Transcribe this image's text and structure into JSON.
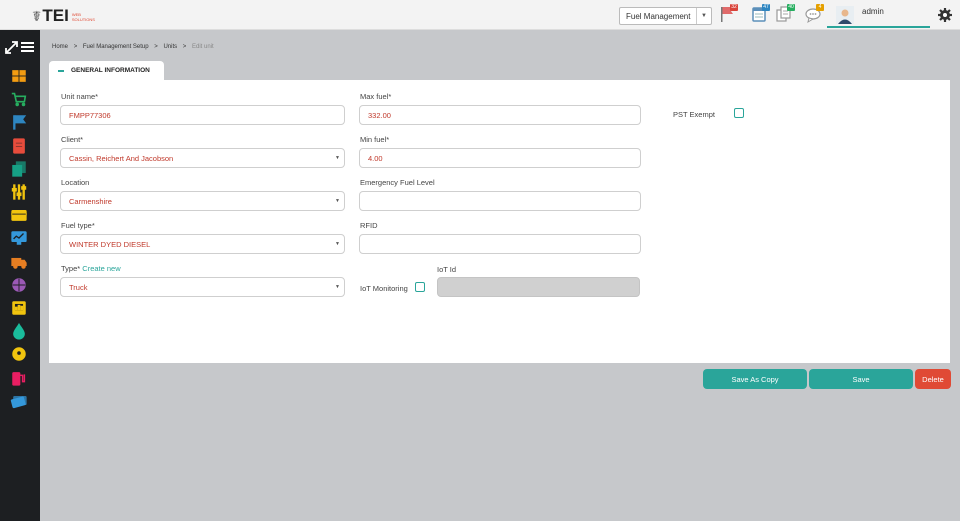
{
  "header": {
    "logo": {
      "brand": "TEI",
      "sub_line1": "WEB",
      "sub_line2": "SOLUTIONS"
    },
    "module_select": {
      "value": "Fuel Management"
    },
    "notifications": [
      {
        "icon": "flag-icon",
        "count": "32",
        "color": "#d9433a"
      },
      {
        "icon": "calendar-icon",
        "count": "47",
        "color": "#2e86c1"
      },
      {
        "icon": "document-icon",
        "count": "40",
        "color": "#27ae60"
      },
      {
        "icon": "chat-icon",
        "count": "4",
        "color": "#e5a000"
      }
    ],
    "user": {
      "name": "admin"
    }
  },
  "sidebar": {
    "items": [
      {
        "icon": "dashboard-icon",
        "color": "#f39c12"
      },
      {
        "icon": "cart-icon",
        "color": "#27ae60"
      },
      {
        "icon": "flag-icon",
        "color": "#2e86c1"
      },
      {
        "icon": "invoice-icon",
        "color": "#e74c3c"
      },
      {
        "icon": "documents-icon",
        "color": "#16a085"
      },
      {
        "icon": "sliders-icon",
        "color": "#f1c40f"
      },
      {
        "icon": "card-icon",
        "color": "#f1c40f"
      },
      {
        "icon": "monitor-chart-icon",
        "color": "#3498db"
      },
      {
        "icon": "truck-icon",
        "color": "#e67e22"
      },
      {
        "icon": "globe-icon",
        "color": "#9b59b6"
      },
      {
        "icon": "report-icon",
        "color": "#f1c40f"
      },
      {
        "icon": "drop-icon",
        "color": "#1abc9c"
      },
      {
        "icon": "gear-user-icon",
        "color": "#f1c40f"
      },
      {
        "icon": "fuel-pump-icon",
        "color": "#e91e63"
      },
      {
        "icon": "cards-icon",
        "color": "#3498db"
      }
    ]
  },
  "breadcrumb": {
    "items": [
      "Home",
      "Fuel Management Setup",
      "Units"
    ],
    "separator": ">",
    "current": "Edit unit"
  },
  "tab": {
    "label": "GENERAL INFORMATION"
  },
  "form": {
    "unit_name": {
      "label": "Unit name*",
      "value": "FMPP77306"
    },
    "client": {
      "label": "Client*",
      "value": "Cassin, Reichert And Jacobson"
    },
    "location": {
      "label": "Location",
      "value": "Carmenshire"
    },
    "fuel_type": {
      "label": "Fuel type*",
      "value": "WINTER DYED DIESEL"
    },
    "type": {
      "label": "Type*",
      "link": "Create new",
      "value": "Truck"
    },
    "max_fuel": {
      "label": "Max fuel*",
      "value": "332.00"
    },
    "min_fuel": {
      "label": "Min fuel*",
      "value": "4.00"
    },
    "emergency_fuel_level": {
      "label": "Emergency Fuel Level",
      "value": ""
    },
    "rfid": {
      "label": "RFID",
      "value": ""
    },
    "iot_monitoring": {
      "label": "IoT Monitoring",
      "checked": false
    },
    "iot_id": {
      "label": "IoT Id",
      "value": ""
    },
    "pst_exempt": {
      "label": "PST Exempt",
      "checked": false
    }
  },
  "actions": {
    "save_as_copy": "Save As Copy",
    "save": "Save",
    "delete": "Delete"
  }
}
